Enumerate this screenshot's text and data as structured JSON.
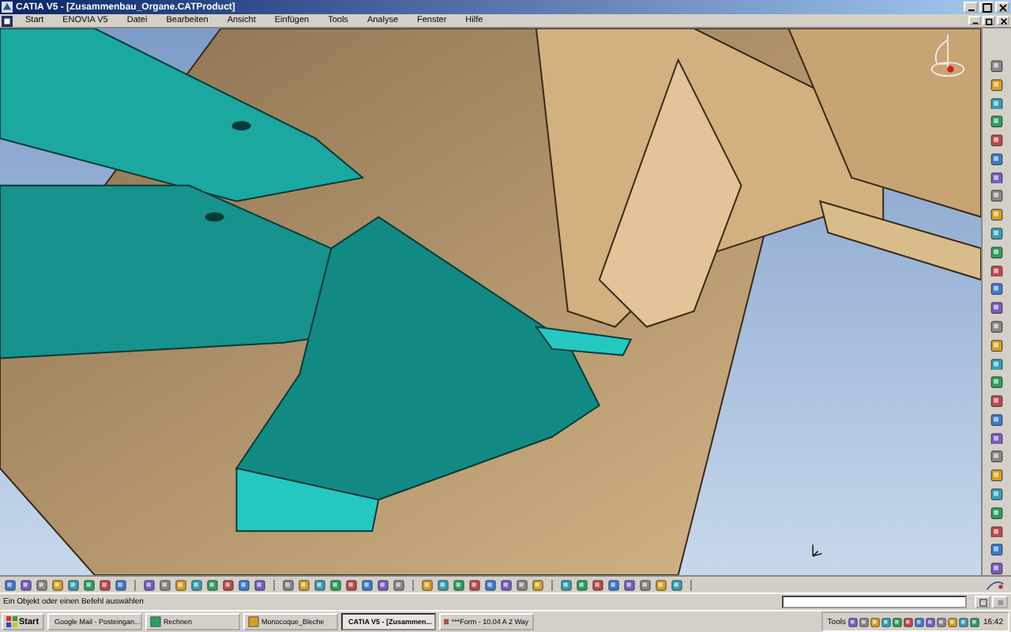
{
  "window": {
    "title": "CATIA V5 - [Zusammenbau_Organe.CATProduct]"
  },
  "menu": [
    "Start",
    "ENOVIA V5",
    "Datei",
    "Bearbeiten",
    "Ansicht",
    "Einfügen",
    "Tools",
    "Analyse",
    "Fenster",
    "Hilfe"
  ],
  "status_bar": {
    "message": "Ein Objekt oder einen Befehl auswählen"
  },
  "taskbar": {
    "start": "Start",
    "items": [
      {
        "label": "Google Mail - Posteingan...",
        "selected": false
      },
      {
        "label": "Rechnen",
        "selected": false
      },
      {
        "label": "Monocoque_Bleche",
        "selected": false
      },
      {
        "label": "CATIA V5 - [Zusammen...",
        "selected": true
      },
      {
        "label": "***Form - 10.04 A 2 Way",
        "selected": false
      }
    ],
    "tray_label": "Tools",
    "clock": "16:42"
  }
}
